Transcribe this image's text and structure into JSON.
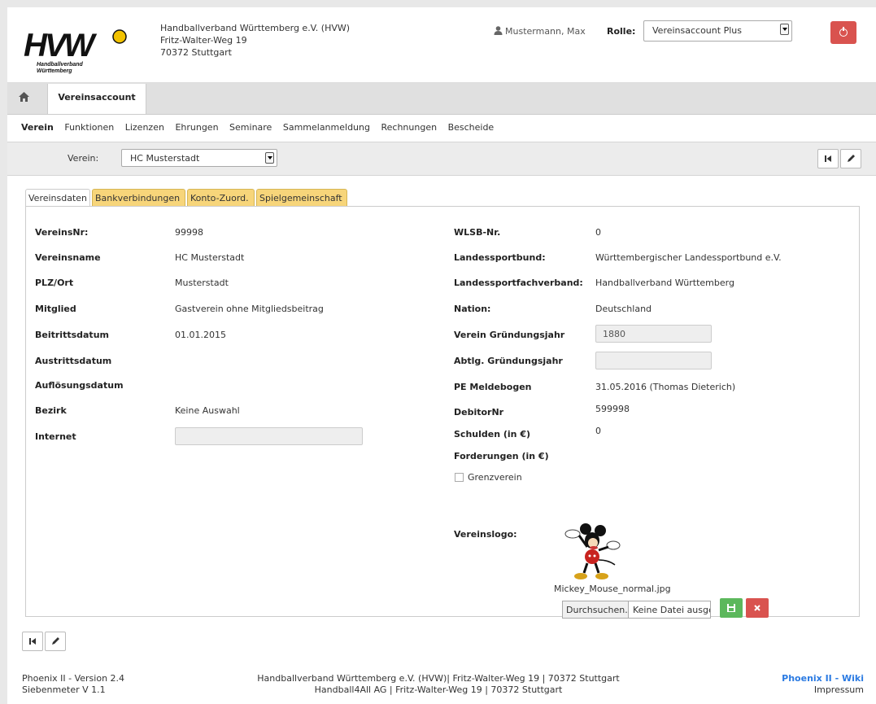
{
  "header": {
    "logo_text": "HVW",
    "logo_sub1": "Handballverband",
    "logo_sub2": "Württemberg",
    "org_line1": "Handballverband Württemberg e.V. (HVW)",
    "org_line2": "Fritz-Walter-Weg 19",
    "org_line3": "70372 Stuttgart",
    "user_name": "Mustermann, Max",
    "rolle_label": "Rolle:",
    "rolle_value": "Vereinsaccount Plus"
  },
  "tabbar": {
    "active_tab": "Vereinsaccount"
  },
  "menu": {
    "items": [
      "Verein",
      "Funktionen",
      "Lizenzen",
      "Ehrungen",
      "Seminare",
      "Sammelanmeldung",
      "Rechnungen",
      "Bescheide"
    ]
  },
  "verein_bar": {
    "label": "Verein:",
    "value": "HC Musterstadt"
  },
  "subtabs": [
    "Vereinsdaten",
    "Bankverbindungen",
    "Konto-Zuord.",
    "Spielgemeinschaft"
  ],
  "left_fields": {
    "vereinsnr_label": "VereinsNr:",
    "vereinsnr_value": "99998",
    "vereinsname_label": "Vereinsname",
    "vereinsname_value": "HC Musterstadt",
    "plz_label": "PLZ/Ort",
    "plz_value": "Musterstadt",
    "mitglied_label": "Mitglied",
    "mitglied_value": "Gastverein ohne Mitgliedsbeitrag",
    "beitritt_label": "Beitrittsdatum",
    "beitritt_value": "01.01.2015",
    "austritt_label": "Austrittsdatum",
    "aufloesung_label": "Auflösungsdatum",
    "bezirk_label": "Bezirk",
    "bezirk_value": "Keine Auswahl",
    "internet_label": "Internet",
    "internet_value": ""
  },
  "right_fields": {
    "wlsb_label": "WLSB-Nr.",
    "wlsb_value": "0",
    "lsb_label": "Landessportbund:",
    "lsb_value": "Württembergischer Landessportbund e.V.",
    "lsfv_label": "Landessportfachverband:",
    "lsfv_value": "Handballverband Württemberg",
    "nation_label": "Nation:",
    "nation_value": "Deutschland",
    "gruendung_label": "Verein Gründungsjahr",
    "gruendung_value": "1880",
    "abtlg_label": "Abtlg. Gründungsjahr",
    "abtlg_value": "",
    "pe_label": "PE Meldebogen",
    "pe_value": "31.05.2016 (Thomas Dieterich)",
    "debitor_label": "DebitorNr",
    "debitor_value": "599998",
    "schulden_label": "Schulden (in €)",
    "schulden_value": "0",
    "forderungen_label": "Forderungen (in €)",
    "grenzverein_label": "Grenzverein",
    "logo_label": "Vereinslogo:",
    "logo_filename": "Mickey_Mouse_normal.jpg",
    "browse_label": "Durchsuchen...",
    "no_file_label": "Keine Datei ausgewählt."
  },
  "footer": {
    "version": "Phoenix II - Version 2.4",
    "siebenmeter": "Siebenmeter V 1.1",
    "center_line1": "Handballverband Württemberg e.V. (HVW)| Fritz-Walter-Weg 19 | 70372 Stuttgart",
    "center_line2": "Handball4All AG | Fritz-Walter-Weg 19 | 70372 Stuttgart",
    "wiki": "Phoenix II - Wiki",
    "impressum": "Impressum"
  },
  "colors": {
    "tab_yellow": "#f7d57a",
    "danger": "#d9534f",
    "success": "#5cb85c",
    "link": "#2a7ae2"
  }
}
